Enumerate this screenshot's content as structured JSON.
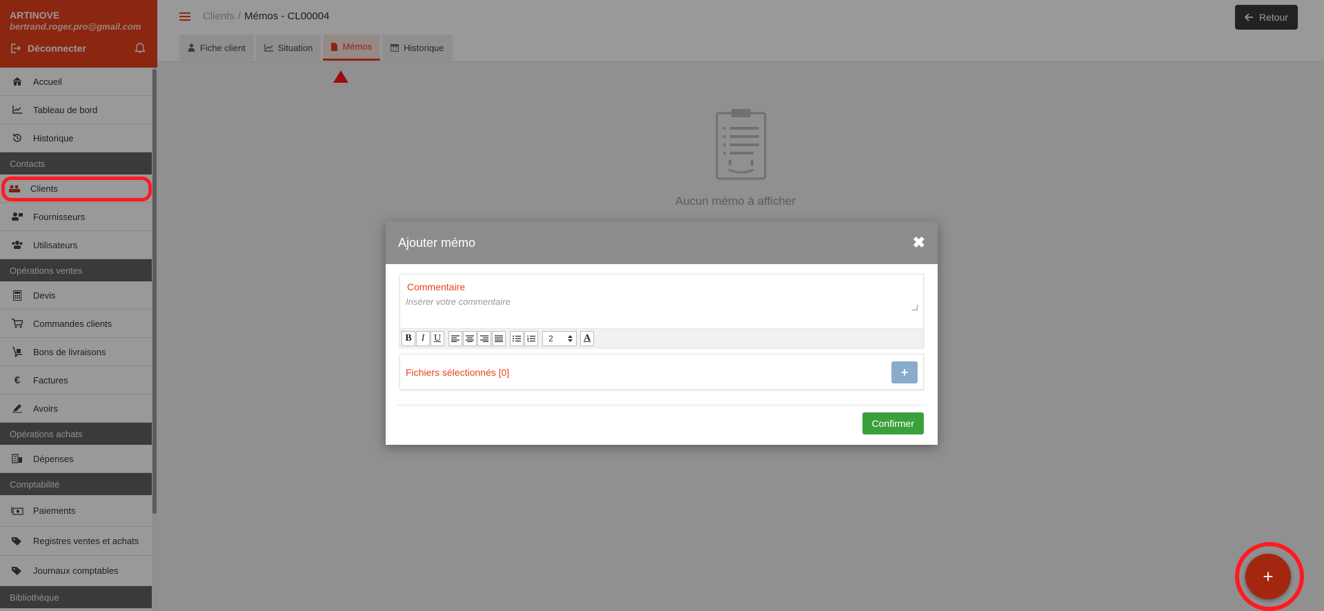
{
  "sidebar": {
    "company": "ARTINOVE",
    "email": "bertrand.roger.pro@gmail.com",
    "logout_label": "Déconnecter",
    "items": [
      {
        "label": "Accueil",
        "icon": "home-icon"
      },
      {
        "label": "Tableau de bord",
        "icon": "chart-icon"
      },
      {
        "label": "Historique",
        "icon": "history-icon"
      }
    ],
    "section_contacts": "Contacts",
    "contacts": [
      {
        "label": "Clients",
        "icon": "clients-icon"
      },
      {
        "label": "Fournisseurs",
        "icon": "suppliers-icon"
      },
      {
        "label": "Utilisateurs",
        "icon": "users-icon"
      }
    ],
    "section_ventes": "Opérations ventes",
    "ventes": [
      {
        "label": "Devis",
        "icon": "calculator-icon"
      },
      {
        "label": "Commandes clients",
        "icon": "cart-icon"
      },
      {
        "label": "Bons de livraisons",
        "icon": "delivery-icon"
      },
      {
        "label": "Factures",
        "icon": "euro-icon"
      },
      {
        "label": "Avoirs",
        "icon": "pen-icon"
      }
    ],
    "section_achats": "Opérations achats",
    "achats": [
      {
        "label": "Dépenses",
        "icon": "expenses-icon"
      }
    ],
    "section_compta": "Comptabilité",
    "compta": [
      {
        "label": "Paiements",
        "icon": "money-icon"
      },
      {
        "label": "Registres ventes et achats",
        "icon": "tags-icon"
      },
      {
        "label": "Journaux comptables",
        "icon": "tags-icon"
      }
    ],
    "section_biblio": "Bibliothèque"
  },
  "header": {
    "breadcrumb_parent": "Clients",
    "breadcrumb_sep": "/",
    "breadcrumb_current": "Mémos - CL00004",
    "back_label": "Retour"
  },
  "tabs": [
    {
      "label": "Fiche client",
      "icon": "user-icon"
    },
    {
      "label": "Situation",
      "icon": "chart-icon"
    },
    {
      "label": "Mémos",
      "icon": "file-icon",
      "active": true
    },
    {
      "label": "Historique",
      "icon": "calendar-icon"
    }
  ],
  "empty_state": {
    "message": "Aucun mémo à afficher"
  },
  "modal": {
    "title": "Ajouter mémo",
    "close_symbol": "✖",
    "comment_label": "Commentaire",
    "comment_placeholder": "Insérer votre commentaire",
    "font_size_value": "2",
    "files_label": "Fichiers sélectionnés [0]",
    "add_file_symbol": "+",
    "confirm_label": "Confirmer"
  },
  "fab": {
    "symbol": "+"
  },
  "colors": {
    "brand": "#e8401c",
    "confirm": "#3aa03a",
    "highlight": "#ff1a22"
  }
}
